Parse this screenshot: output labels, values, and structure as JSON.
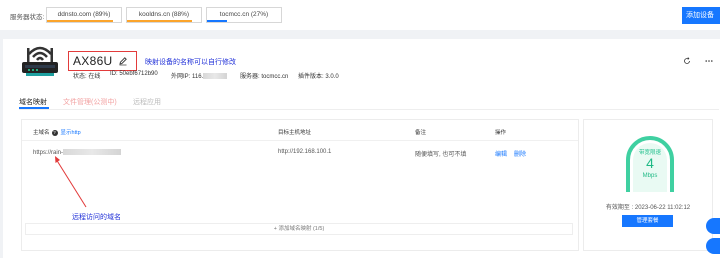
{
  "topbar": {
    "status_label": "服务器状态:",
    "servers": [
      {
        "name": "ddnsto.com (89%)",
        "percent": 89,
        "color": "#fba42b"
      },
      {
        "name": "kooldns.cn (88%)",
        "percent": 88,
        "color": "#fba42b"
      },
      {
        "name": "tocmcc.cn (27%)",
        "percent": 27,
        "color": "#1677ff"
      }
    ],
    "add_device": "添加设备"
  },
  "device": {
    "name": "AX86U",
    "annotation": "映射设备的名称可以自行修改",
    "status_label": "状态:",
    "status_value": "在线",
    "id_label": "ID:",
    "id_value": "50ebf6712b90",
    "ip_label": "外网IP:",
    "ip_value": "116.",
    "server_label": "服务器:",
    "server_value": "tocmcc.cn",
    "plugin_label": "插件版本:",
    "plugin_value": "3.0.0"
  },
  "tabs": [
    {
      "label": "域名映射",
      "active": true
    },
    {
      "label": "文件管理(公测中)",
      "active": false
    },
    {
      "label": "远程应用",
      "active": false
    }
  ],
  "table": {
    "headers": {
      "domain": "主域名",
      "show_http": "显示http",
      "target": "目标主机地址",
      "remark": "备注",
      "action": "操作"
    },
    "rows": [
      {
        "domain": "https://rain-",
        "target": "http://192.168.100.1",
        "remark": "随便填写, 也可不填",
        "edit": "编辑",
        "delete": "删除"
      }
    ],
    "add_mapping": "+ 添加域名映射 (1/5)"
  },
  "annotation_domain": "远程访问的域名",
  "speed": {
    "label": "带宽限速",
    "value": "4",
    "unit": "Mbps",
    "expire": "有效期至 : 2023-06-22 11:02:12",
    "manage_button": "管理套餐"
  },
  "colors": {
    "accent": "#1677ff",
    "annotation": "#2030d8",
    "highlight_box": "#e23b3b",
    "gauge_green": "#1fb985"
  }
}
